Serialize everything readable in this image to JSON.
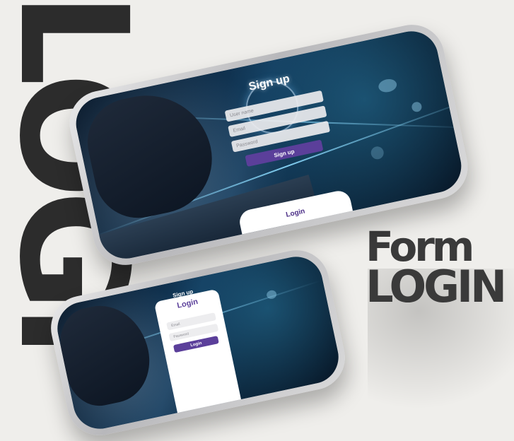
{
  "background": {
    "letters": "LOGI"
  },
  "headline": {
    "line1": "Form",
    "line2": "LOGIN"
  },
  "phone_main": {
    "title": "Sign up",
    "username_placeholder": "User name",
    "email_placeholder": "Email",
    "password_placeholder": "Password",
    "signup_button": "Sign up",
    "login_button": "Login"
  },
  "phone_small": {
    "title": "Login",
    "behind_title": "Sign up",
    "email_placeholder": "Email",
    "password_placeholder": "Password",
    "login_button": "Login"
  },
  "colors": {
    "accent": "#5b3f9a",
    "background": "#efeeeb",
    "text_dark": "#3a3a3a"
  }
}
